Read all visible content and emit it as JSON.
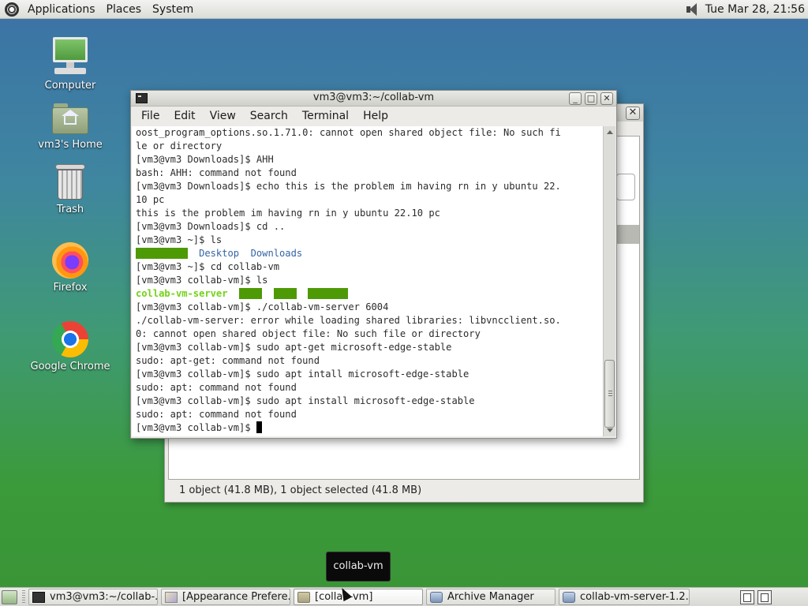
{
  "top_panel": {
    "menus": [
      "Applications",
      "Places",
      "System"
    ],
    "clock": "Tue Mar 28, 21:56"
  },
  "desktop_icons": [
    {
      "label": "Computer"
    },
    {
      "label": "vm3's Home"
    },
    {
      "label": "Trash"
    },
    {
      "label": "Firefox"
    },
    {
      "label": "Google Chrome"
    }
  ],
  "file_manager": {
    "status": "1 object (41.8 MB), 1 object selected (41.8 MB)",
    "close_symbol": "✕"
  },
  "terminal": {
    "title": "vm3@vm3:~/collab-vm",
    "buttons": {
      "minimize": "_",
      "maximize": "□",
      "close": "✕"
    },
    "menus": [
      "File",
      "Edit",
      "View",
      "Search",
      "Terminal",
      "Help"
    ],
    "lines": [
      "oost_program_options.so.1.71.0: cannot open shared object file: No such fi",
      "le or directory",
      "[vm3@vm3 Downloads]$ AHH",
      "bash: AHH: command not found",
      "[vm3@vm3 Downloads]$ echo this is the problem im having rn in y ubuntu 22.",
      "10 pc",
      "this is the problem im having rn in y ubuntu 22.10 pc",
      "[vm3@vm3 Downloads]$ cd ..",
      "[vm3@vm3 ~]$ ls"
    ],
    "ls_home": {
      "hidden_item": "collab-vm",
      "dir1": "Desktop",
      "dir2": "Downloads"
    },
    "lines2": [
      "[vm3@vm3 ~]$ cd collab-vm",
      "[vm3@vm3 collab-vm]$ ls"
    ],
    "ls_collab": {
      "exec": "collab-vm-server",
      "h1": "html",
      "h2": "http",
      "h3": "scripts"
    },
    "lines3": [
      "[vm3@vm3 collab-vm]$ ./collab-vm-server 6004",
      "./collab-vm-server: error while loading shared libraries: libvncclient.so.",
      "0: cannot open shared object file: No such file or directory",
      "[vm3@vm3 collab-vm]$ sudo apt-get microsoft-edge-stable",
      "sudo: apt-get: command not found",
      "[vm3@vm3 collab-vm]$ sudo apt intall microsoft-edge-stable",
      "sudo: apt: command not found",
      "[vm3@vm3 collab-vm]$ sudo apt install microsoft-edge-stable",
      "sudo: apt: command not found"
    ],
    "prompt": "[vm3@vm3 collab-vm]$ "
  },
  "tooltip": "collab-vm",
  "taskbar": [
    {
      "label": "vm3@vm3:~/collab-...",
      "icon": "terminal-icon"
    },
    {
      "label": "[Appearance Prefere...",
      "icon": "appearance-icon"
    },
    {
      "label": "[collab-vm]",
      "icon": "folder-icon"
    },
    {
      "label": "Archive Manager",
      "icon": "archive-icon"
    },
    {
      "label": "collab-vm-server-1.2....",
      "icon": "archive-icon"
    }
  ]
}
